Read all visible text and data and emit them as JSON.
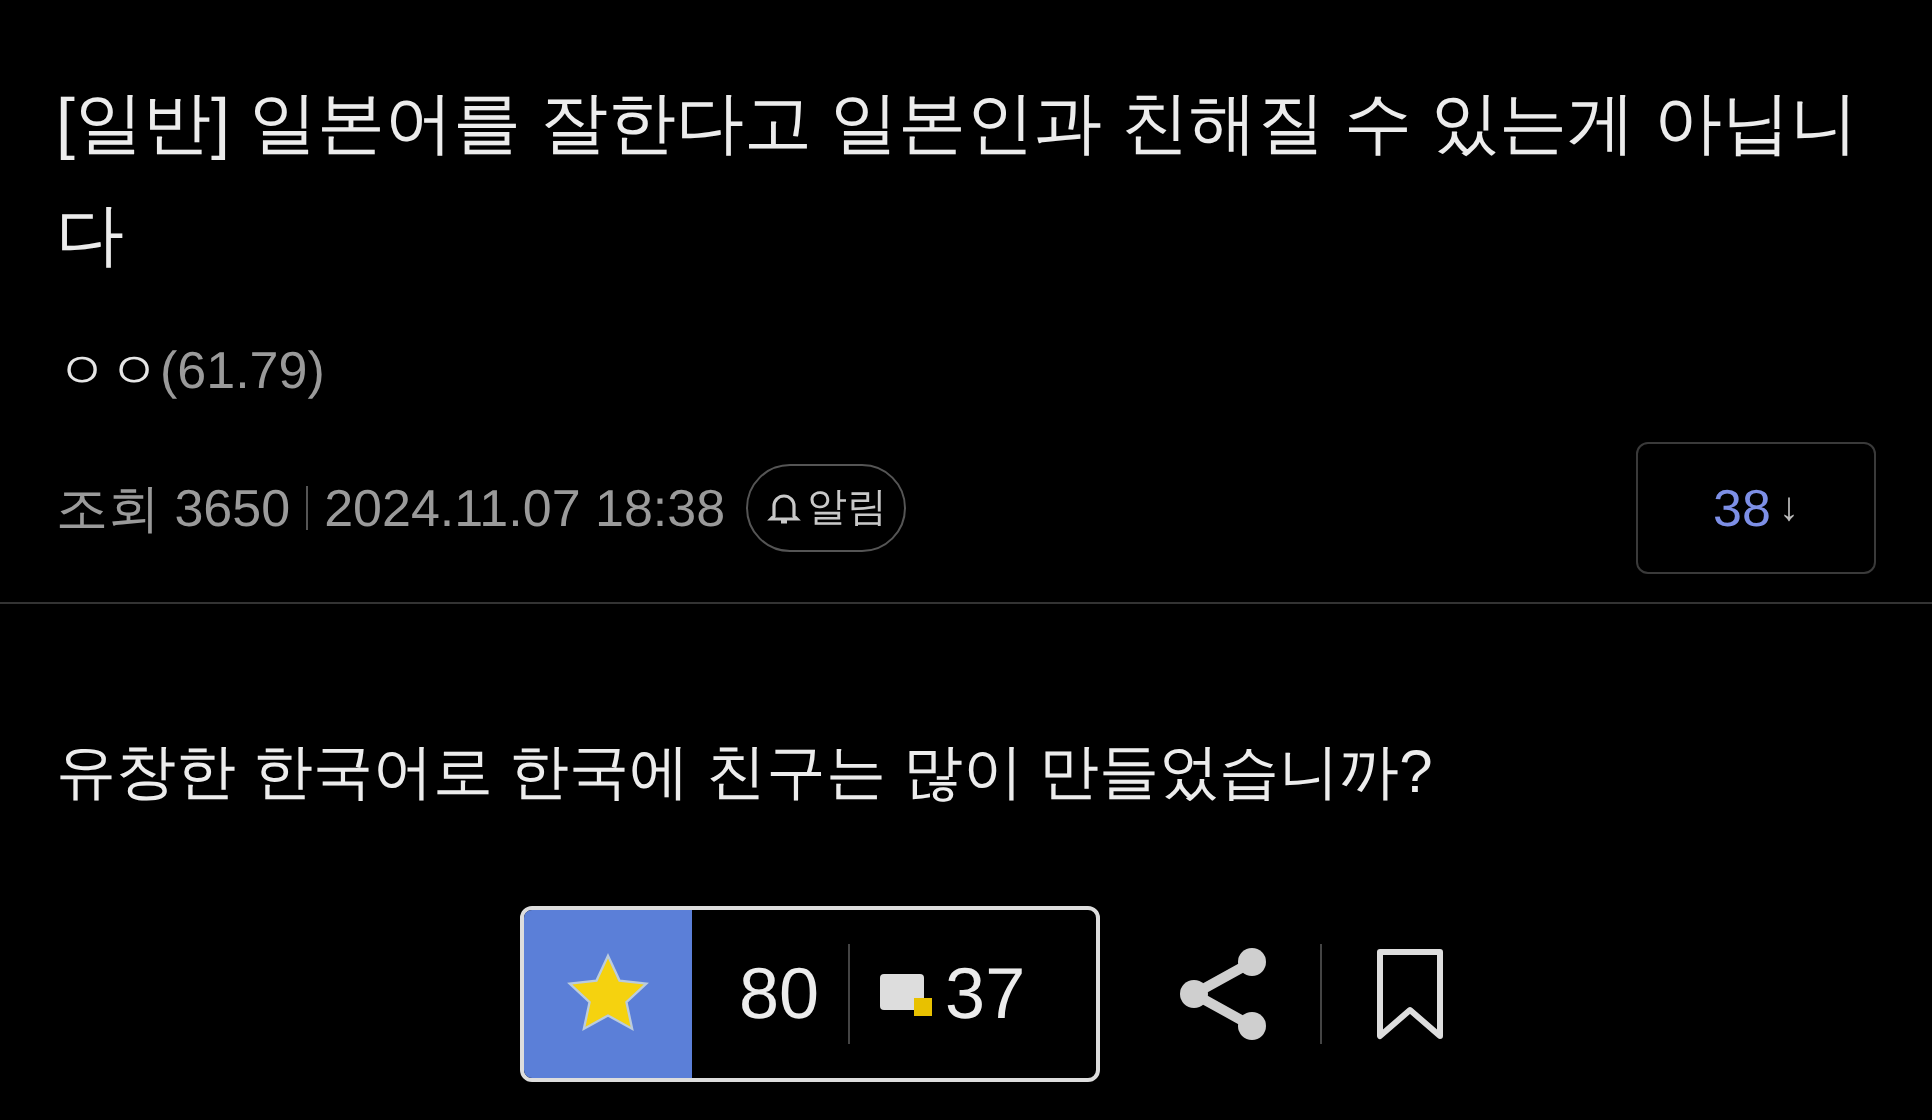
{
  "post": {
    "title": "[일반] 일본어를 잘한다고 일본인과 친해질 수 있는게 아닙니다",
    "author": "ㅇㅇ",
    "author_ip": "(61.79)",
    "views_label": "조회",
    "views": "3650",
    "datetime": "2024.11.07 18:38",
    "alert_label": "알림",
    "comment_count": "38",
    "comment_arrow": "↓",
    "body": "유창한 한국어로 한국에 친구는 많이 만들었습니까?"
  },
  "actions": {
    "recommended": true,
    "recommend_count": "80",
    "reward_count": "37"
  }
}
